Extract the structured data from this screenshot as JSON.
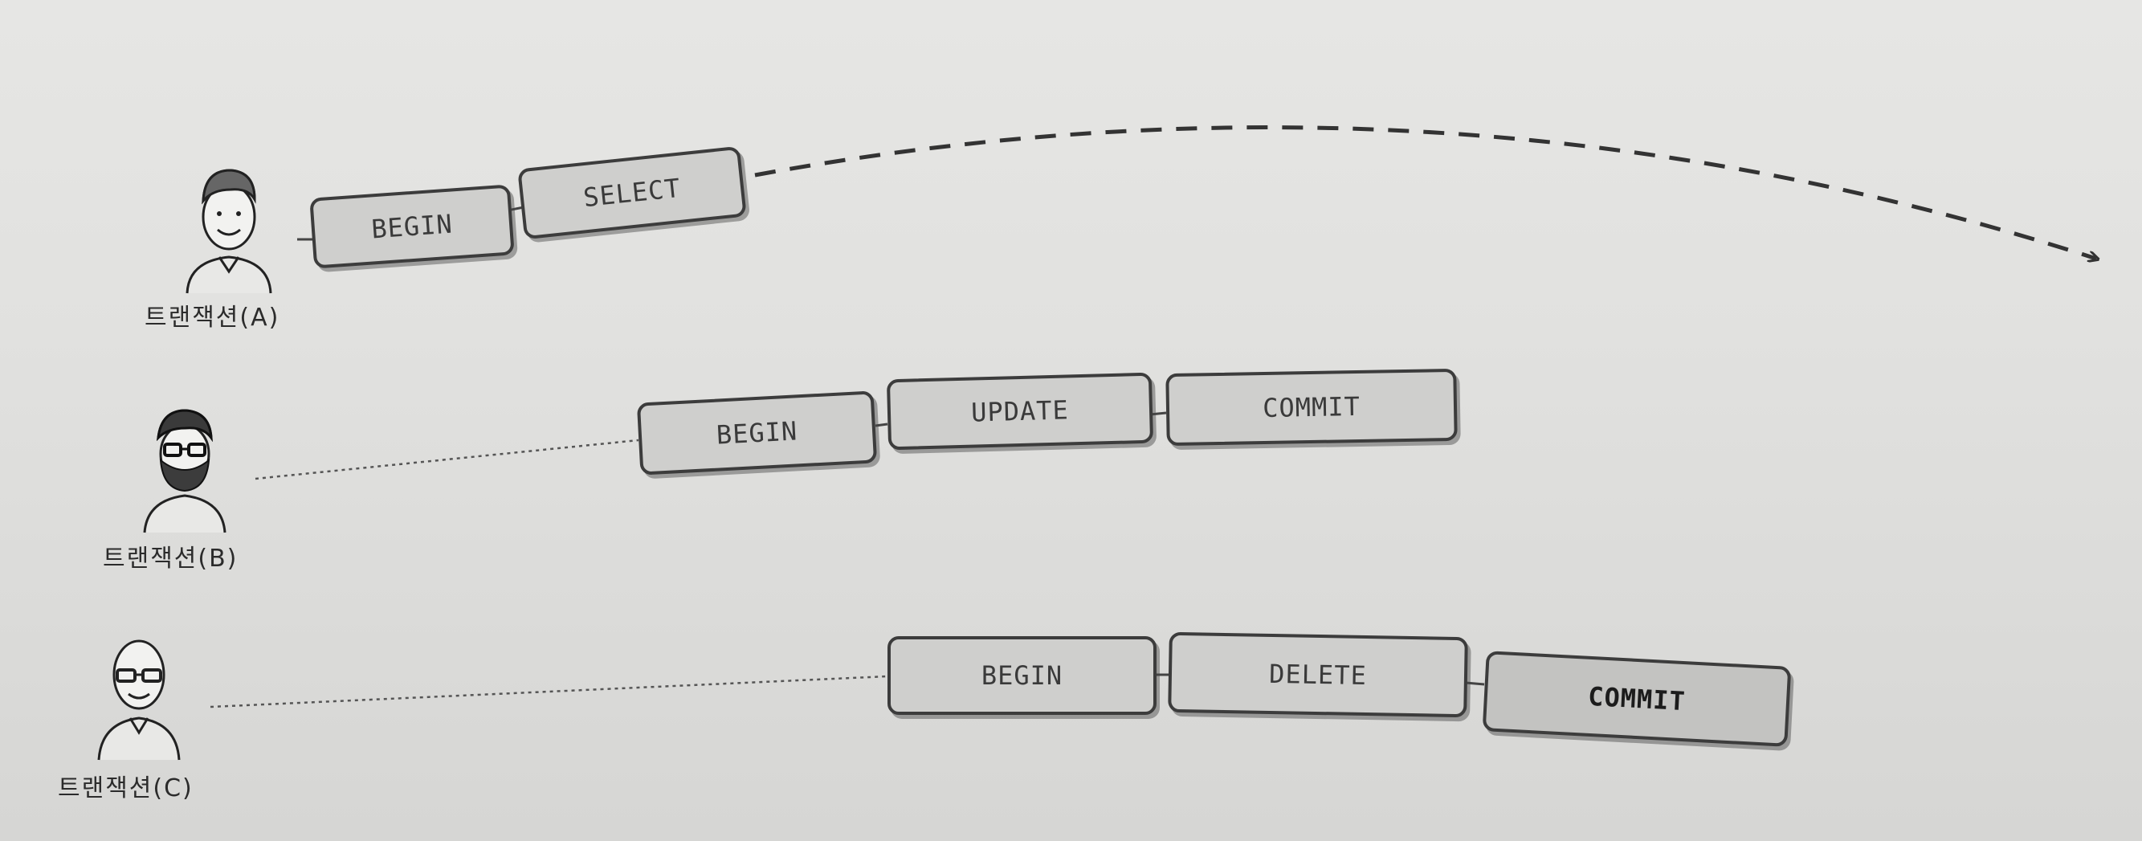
{
  "transactions": [
    {
      "label": "트랜잭션(A)",
      "avatar_icon": "man-short-hair-icon",
      "statements": [
        "BEGIN",
        "SELECT"
      ],
      "continues": true
    },
    {
      "label": "트랜잭션(B)",
      "avatar_icon": "bearded-man-glasses-icon",
      "statements": [
        "BEGIN",
        "UPDATE",
        "COMMIT"
      ],
      "continues": false
    },
    {
      "label": "트랜잭션(C)",
      "avatar_icon": "bald-man-glasses-icon",
      "statements": [
        "BEGIN",
        "DELETE",
        "COMMIT"
      ],
      "continues": false
    }
  ],
  "colors": {
    "block_fill": "#cfcfcd",
    "block_border": "#3c3c3c",
    "line": "#444444"
  }
}
